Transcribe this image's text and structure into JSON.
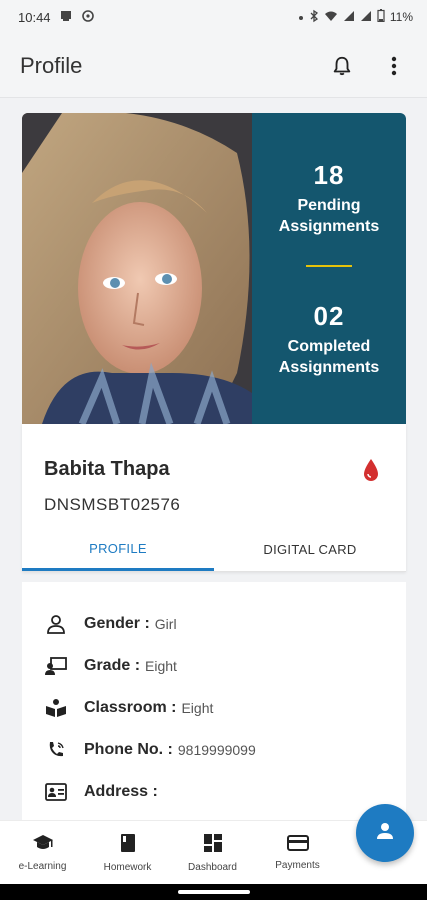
{
  "status_bar": {
    "time": "10:44",
    "battery": "11%"
  },
  "app_bar": {
    "title": "Profile",
    "icons": [
      "bell-icon",
      "more-vert-icon"
    ]
  },
  "hero": {
    "pending": {
      "count": "18",
      "label": "Pending Assignments"
    },
    "completed": {
      "count": "02",
      "label": "Completed Assignments"
    },
    "colors": {
      "panel": "#14566e",
      "divider": "#e6c20a"
    }
  },
  "profile_card": {
    "name": "Babita Thapa",
    "student_id": "DNSMSBT02576",
    "blood_icon_color": "#d32f2f",
    "tabs": [
      {
        "label": "PROFILE",
        "active": true
      },
      {
        "label": "DIGITAL CARD",
        "active": false
      }
    ],
    "accent": "#1e7bc2"
  },
  "details": [
    {
      "icon": "person-icon",
      "key": "Gender :",
      "value": "Girl"
    },
    {
      "icon": "grade-icon",
      "key": "Grade :",
      "value": "Eight"
    },
    {
      "icon": "classroom-icon",
      "key": "Classroom :",
      "value": "Eight"
    },
    {
      "icon": "phone-icon",
      "key": "Phone No. :",
      "value": "9819999099"
    },
    {
      "icon": "address-card-icon",
      "key": "Address :",
      "value": ""
    }
  ],
  "bottom_nav": [
    {
      "icon": "graduation-cap-icon",
      "label": "e-Learning"
    },
    {
      "icon": "book-icon",
      "label": "Homework"
    },
    {
      "icon": "dashboard-icon",
      "label": "Dashboard"
    },
    {
      "icon": "payment-card-icon",
      "label": "Payments"
    }
  ],
  "fab": {
    "icon": "person-icon"
  }
}
